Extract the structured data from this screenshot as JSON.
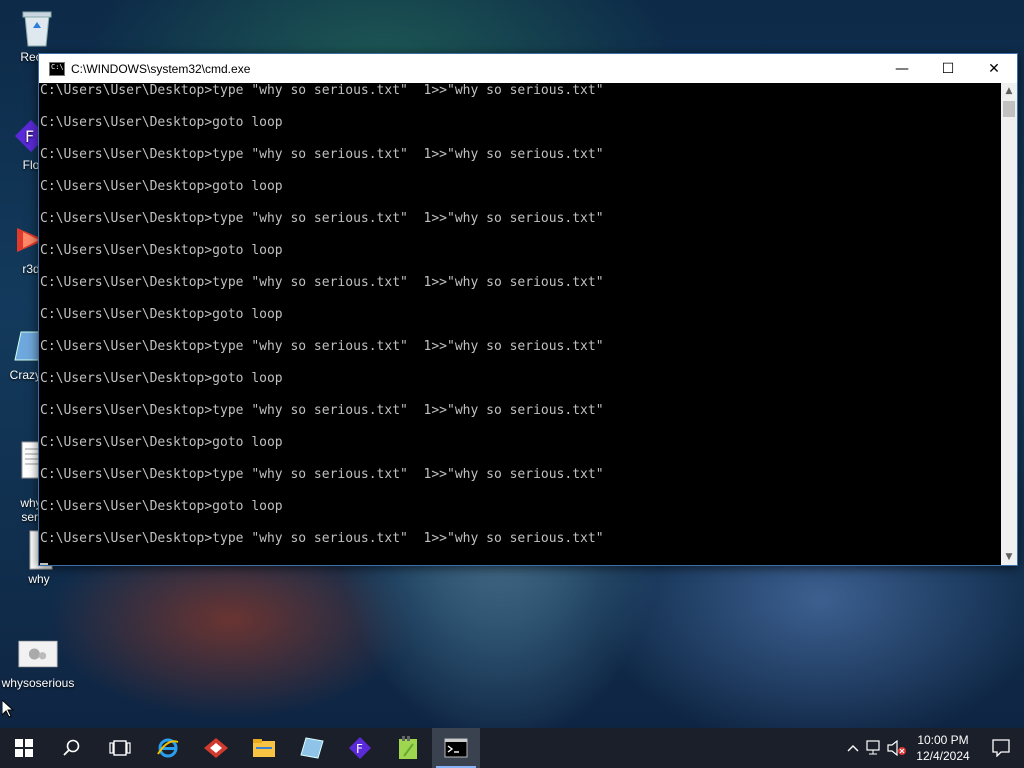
{
  "desktop": {
    "icons": [
      {
        "label": "Recyc",
        "icon": "recycle-bin-icon"
      },
      {
        "label": "Flo",
        "icon": "app-f-icon"
      },
      {
        "label": "r3d",
        "icon": "r3d-icon"
      },
      {
        "label": "Crazy E",
        "icon": "crazy-e-icon"
      },
      {
        "label": "why\nseri",
        "icon": "text-file-icon"
      },
      {
        "label": "why",
        "icon": "file-icon"
      },
      {
        "label": "whysoserious",
        "icon": "settings-file-icon"
      }
    ]
  },
  "cmd_window": {
    "title": "C:\\WINDOWS\\system32\\cmd.exe",
    "lines": [
      "C:\\Users\\User\\Desktop>type \"why so serious.txt\"  1>>\"why so serious.txt\"",
      "C:\\Users\\User\\Desktop>goto loop",
      "C:\\Users\\User\\Desktop>type \"why so serious.txt\"  1>>\"why so serious.txt\"",
      "C:\\Users\\User\\Desktop>goto loop",
      "C:\\Users\\User\\Desktop>type \"why so serious.txt\"  1>>\"why so serious.txt\"",
      "C:\\Users\\User\\Desktop>goto loop",
      "C:\\Users\\User\\Desktop>type \"why so serious.txt\"  1>>\"why so serious.txt\"",
      "C:\\Users\\User\\Desktop>goto loop",
      "C:\\Users\\User\\Desktop>type \"why so serious.txt\"  1>>\"why so serious.txt\"",
      "C:\\Users\\User\\Desktop>goto loop",
      "C:\\Users\\User\\Desktop>type \"why so serious.txt\"  1>>\"why so serious.txt\"",
      "C:\\Users\\User\\Desktop>goto loop",
      "C:\\Users\\User\\Desktop>type \"why so serious.txt\"  1>>\"why so serious.txt\"",
      "C:\\Users\\User\\Desktop>goto loop",
      "C:\\Users\\User\\Desktop>type \"why so serious.txt\"  1>>\"why so serious.txt\""
    ],
    "controls": {
      "minimize": "—",
      "maximize": "☐",
      "close": "✕"
    }
  },
  "taskbar": {
    "apps": [
      {
        "icon": "start-icon"
      },
      {
        "icon": "search-icon"
      },
      {
        "icon": "task-view-icon"
      },
      {
        "icon": "internet-explorer-icon"
      },
      {
        "icon": "red-app-icon"
      },
      {
        "icon": "file-explorer-icon"
      },
      {
        "icon": "blue-app-icon"
      },
      {
        "icon": "flo-app-icon"
      },
      {
        "icon": "notepad-plus-icon"
      },
      {
        "icon": "cmd-icon"
      }
    ],
    "tray": {
      "time": "10:00 PM",
      "date": "12/4/2024"
    }
  },
  "colors": {
    "console_text": "#c0c0c0",
    "console_bg": "#000000",
    "taskbar_bg": "#1a1f2a",
    "accent": "#3c6ea8"
  }
}
